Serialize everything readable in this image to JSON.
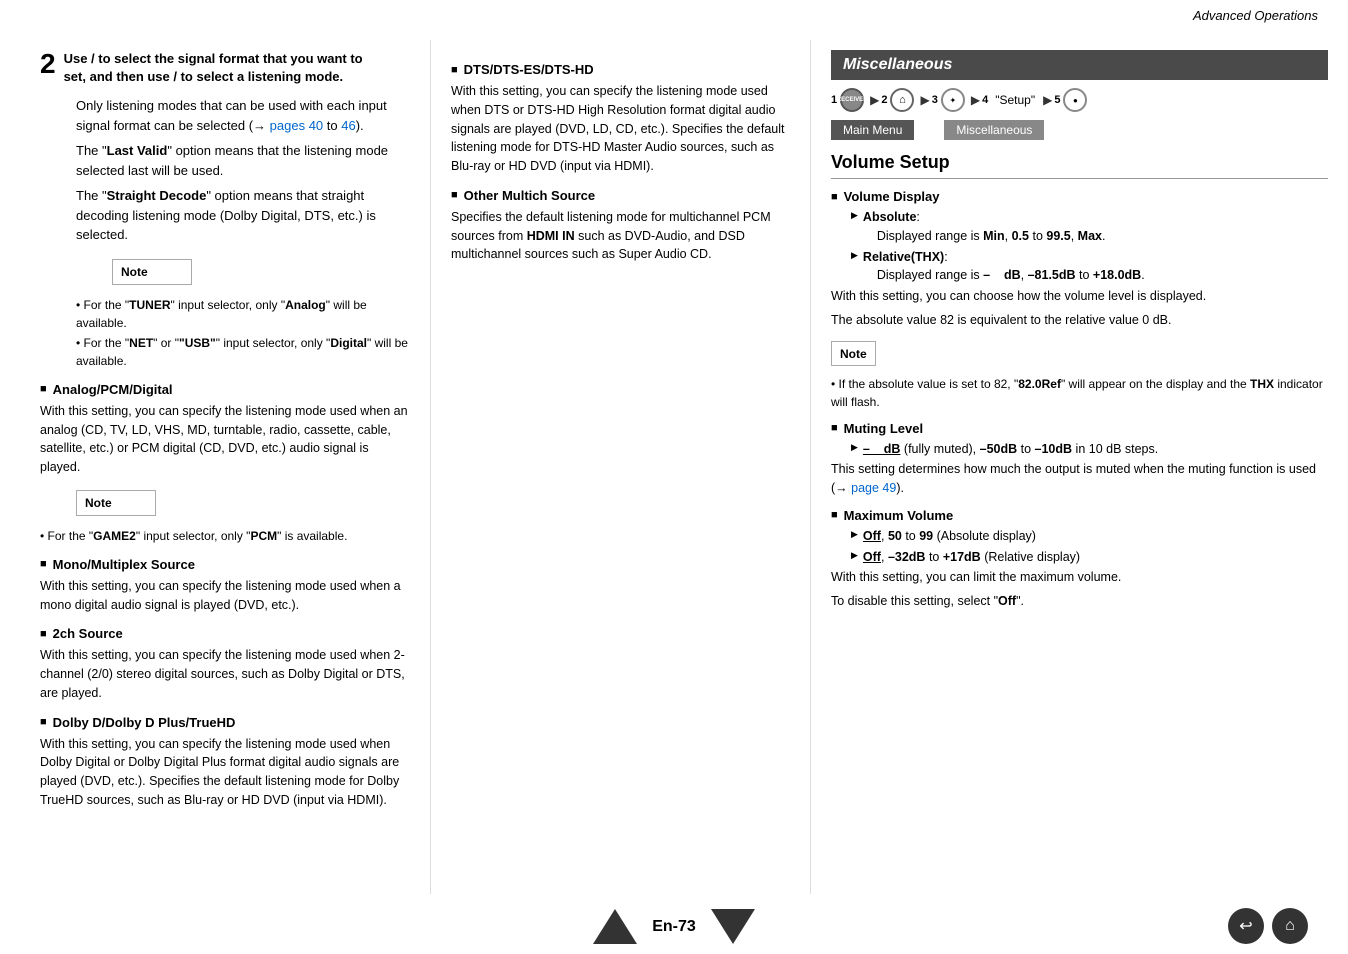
{
  "header": {
    "title": "Advanced Operations"
  },
  "left_col": {
    "step": {
      "num": "2",
      "line1": "Use  /   to select the signal format that you want to",
      "line2": "set, and then use  /   to select a listening mode."
    },
    "intro_text": [
      "Only listening modes that can be used with each input signal format can be selected (→ pages 40 to 46).",
      "The \"Last Valid\" option means that the listening mode selected last will be used.",
      "The \"Straight Decode\" option means that straight decoding listening mode (Dolby Digital, DTS, etc.) is selected."
    ],
    "note": {
      "label": "Note",
      "items": [
        "For the \"TUNER\" input selector, only \"Analog\" will be available.",
        "For the \"NET\" or \"USB\" input selector, only \"Digital\" will be available."
      ]
    },
    "sections": [
      {
        "id": "analog",
        "heading": "Analog/PCM/Digital",
        "body": "With this setting, you can specify the listening mode used when an analog (CD, TV, LD, VHS, MD, turntable, radio, cassette, cable, satellite, etc.) or PCM digital (CD, DVD, etc.) audio signal is played."
      },
      {
        "id": "analog-note",
        "is_note": true,
        "items": [
          "For the \"GAME2\" input selector, only \"PCM\" is available."
        ]
      },
      {
        "id": "mono",
        "heading": "Mono/Multiplex Source",
        "body": "With this setting, you can specify the listening mode used when a mono digital audio signal is played (DVD, etc.)."
      },
      {
        "id": "2ch",
        "heading": "2ch Source",
        "body": "With this setting, you can specify the listening mode used when 2-channel (2/0) stereo digital sources, such as Dolby Digital or DTS, are played."
      },
      {
        "id": "dolby",
        "heading": "Dolby D/Dolby D Plus/TrueHD",
        "body": "With this setting, you can specify the listening mode used when Dolby Digital or Dolby Digital Plus format digital audio signals are played (DVD, etc.). Specifies the default listening mode for Dolby TrueHD sources, such as Blu-ray or HD DVD (input via HDMI)."
      }
    ]
  },
  "mid_col": {
    "sections": [
      {
        "heading": "DTS/DTS-ES/DTS-HD",
        "body": "With this setting, you can specify the listening mode used when DTS or DTS-HD High Resolution format digital audio signals are played (DVD, LD, CD, etc.). Specifies the default listening mode for DTS-HD Master Audio sources, such as Blu-ray or HD DVD (input via HDMI)."
      },
      {
        "heading": "Other Multich Source",
        "body": "Specifies the default listening mode for multichannel PCM sources from HDMI IN such as DVD-Audio, and DSD multichannel sources such as Super Audio CD."
      }
    ]
  },
  "right_col": {
    "misc_title": "Miscellaneous",
    "nav_steps": [
      {
        "num": "1",
        "type": "receiver",
        "label": "RECEIVER"
      },
      {
        "num": "2",
        "type": "home"
      },
      {
        "num": "3",
        "type": "circle"
      },
      {
        "num": "4",
        "type": "setup",
        "label": "\"Setup\""
      },
      {
        "num": "5",
        "type": "circle-small"
      }
    ],
    "breadcrumb": [
      {
        "label": "Main Menu",
        "active": false
      },
      {
        "label": "Miscellaneous",
        "active": true
      }
    ],
    "volume_setup_title": "Volume Setup",
    "sections": [
      {
        "id": "volume-display",
        "heading": "Volume Display",
        "bullets": [
          {
            "label": "Absolute",
            "text": "Displayed range is Min, 0.5 to 99.5, Max."
          },
          {
            "label": "Relative(THX)",
            "text": "Displayed range is –    dB, –81.5dB to +18.0dB."
          }
        ],
        "body_lines": [
          "With this setting, you can choose how the volume level is displayed.",
          "The absolute value 82 is equivalent to the relative value 0 dB."
        ],
        "note": {
          "items": [
            "If the absolute value is set to 82, \"82.0Ref\" will appear on the display and the THX indicator will flash."
          ]
        }
      },
      {
        "id": "muting-level",
        "heading": "Muting Level",
        "bullets": [
          {
            "label": "–    dB",
            "text": "(fully muted), –50dB to –10dB in 10 dB steps."
          }
        ],
        "body_lines": [
          "This setting determines how much the output is muted when the muting function is used (→ page 49)."
        ]
      },
      {
        "id": "maximum-volume",
        "heading": "Maximum Volume",
        "bullets": [
          {
            "label": "Off",
            "text": ", 50 to 99 (Absolute display)"
          },
          {
            "label": "Off",
            "text": ", –32dB to +17dB (Relative display)"
          }
        ],
        "body_lines": [
          "With this setting, you can limit the maximum volume.",
          "To disable this setting, select \"Off\"."
        ]
      }
    ]
  },
  "bottom": {
    "page_label": "En-73",
    "prev_icon": "▲",
    "next_icon": "▼",
    "icons": [
      "↩",
      "⌂"
    ]
  }
}
